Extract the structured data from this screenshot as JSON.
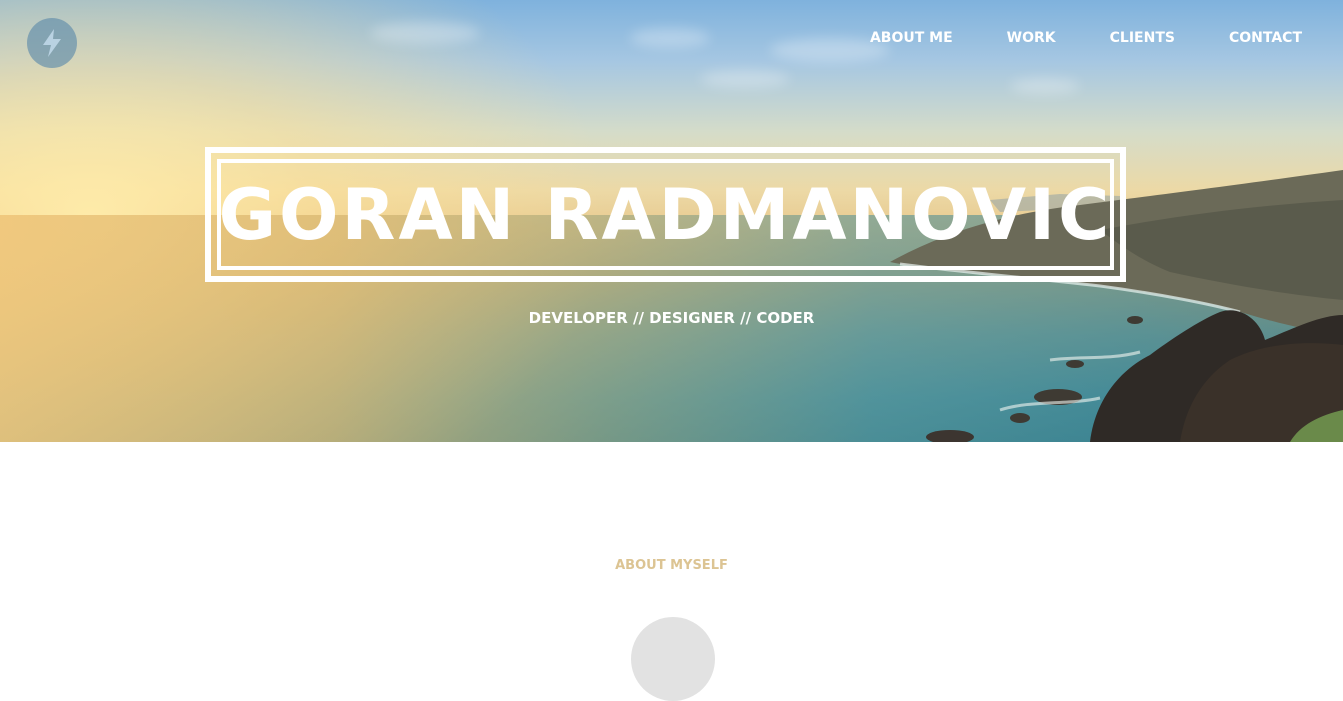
{
  "header": {
    "logo_icon": "lightning-bolt-icon",
    "nav": [
      {
        "label": "ABOUT ME"
      },
      {
        "label": "WORK"
      },
      {
        "label": "CLIENTS"
      },
      {
        "label": "CONTACT"
      }
    ]
  },
  "hero": {
    "title": "GORAN RADMANOVIC",
    "subtitle": "DEVELOPER // DESIGNER // CODER"
  },
  "about": {
    "heading": "ABOUT MYSELF"
  },
  "colors": {
    "accent": "#dcc493",
    "text_on_hero": "#ffffff"
  }
}
